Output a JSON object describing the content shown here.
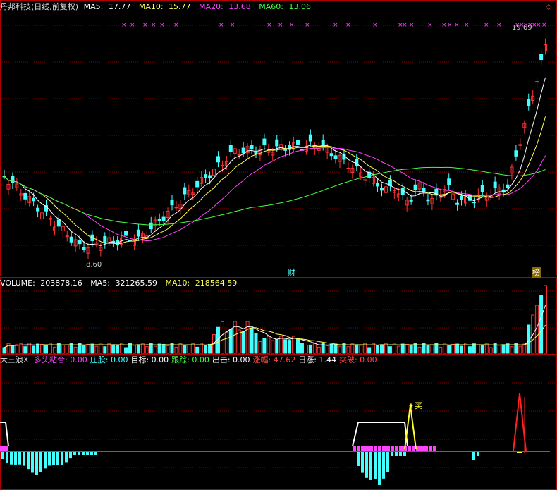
{
  "header": {
    "title": "丹邦科技(日线,前复权)",
    "ma5": {
      "label": "MA5:",
      "value": "17.77",
      "color": "#ffffff"
    },
    "ma10": {
      "label": "MA10:",
      "value": "15.77",
      "color": "#ffff55"
    },
    "ma20": {
      "label": "MA20:",
      "value": "13.68",
      "color": "#ff44ff"
    },
    "ma60": {
      "label": "MA60:",
      "value": "13.06",
      "color": "#44ff44"
    }
  },
  "price_panel": {
    "high_label": "19.69",
    "low_label": "8.60",
    "marker_cai": "财",
    "marker_bang": "榜",
    "corner_icon": "diamond-icon"
  },
  "volume_panel": {
    "volume": {
      "label": "VOLUME:",
      "value": "203878.16"
    },
    "ma5": {
      "label": "MA5:",
      "value": "321265.59"
    },
    "ma10": {
      "label": "MA10:",
      "value": "218564.59"
    }
  },
  "indicator_panel": {
    "name": "大三浪X",
    "items": [
      {
        "label": "多头粘合:",
        "value": "0.00",
        "color": "#ff44ff"
      },
      {
        "label": "庄股:",
        "value": "0.00",
        "color": "#44ffff"
      },
      {
        "label": "目标:",
        "value": "0.00",
        "color": "#ffffff"
      },
      {
        "label": "跟踪:",
        "value": "0.00",
        "color": "#44ff44"
      },
      {
        "label": "出击:",
        "value": "0.00",
        "color": "#ffffff"
      },
      {
        "label": "涨幅:",
        "value": "47.62",
        "color": "#ff4444"
      },
      {
        "label": "日涨:",
        "value": "1.44",
        "color": "#ffffff"
      },
      {
        "label": "突破:",
        "value": "0.00",
        "color": "#ff4444"
      }
    ],
    "buy_label": "买"
  },
  "colors": {
    "up": "#ff3333",
    "down": "#44ffff",
    "grid": "#8b0000",
    "border": "#b00000"
  }
}
